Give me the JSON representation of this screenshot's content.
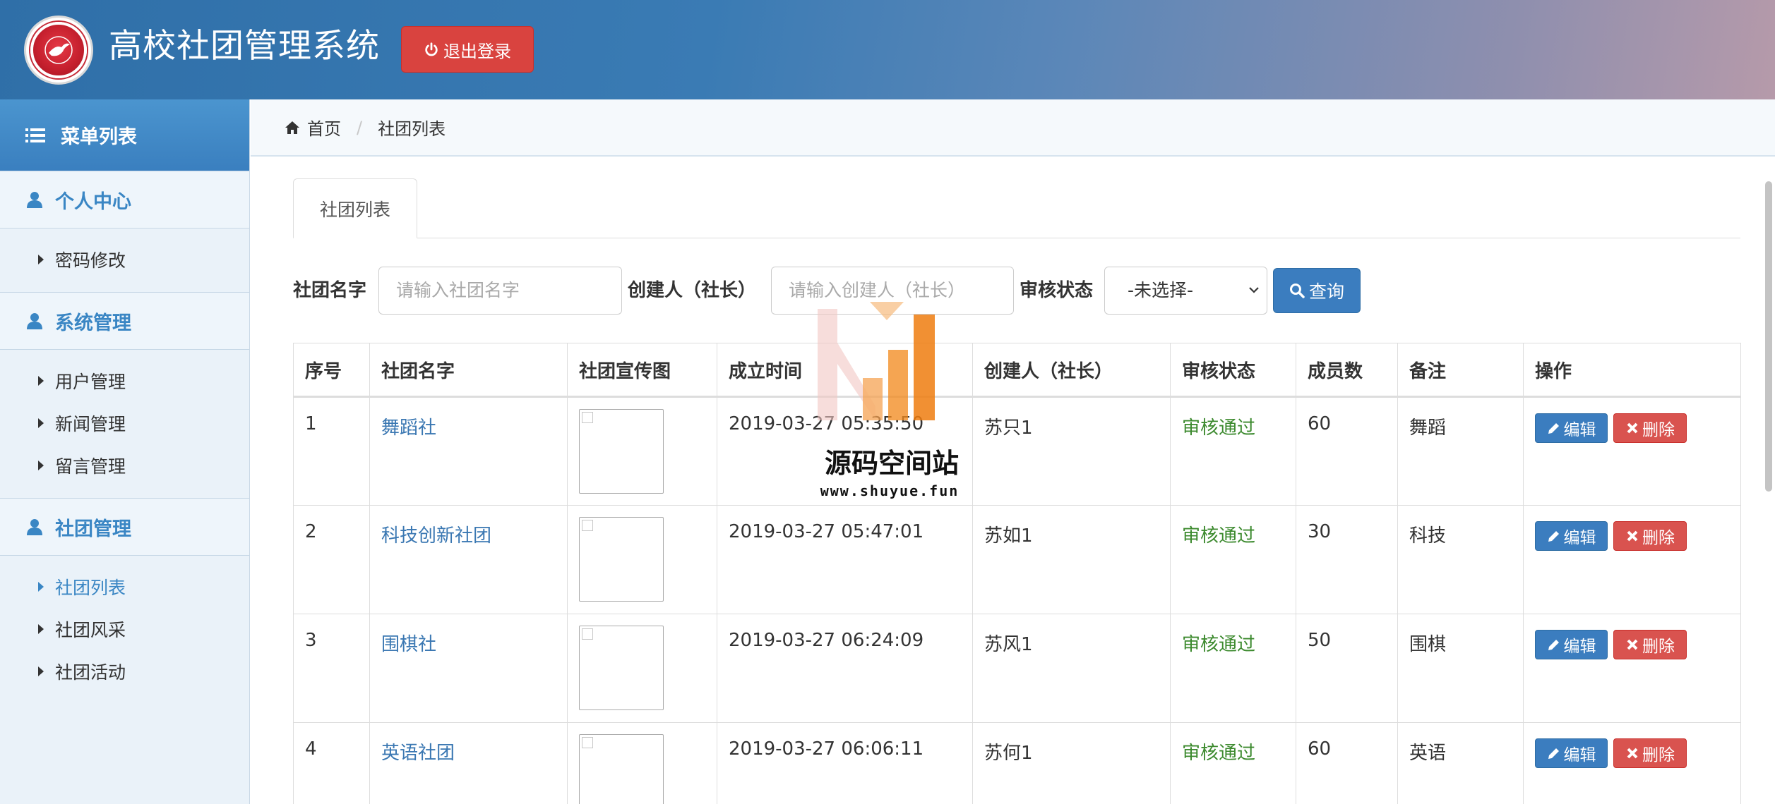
{
  "header": {
    "app_title": "高校社团管理系统",
    "logout_label": "退出登录",
    "colors": {
      "logout": "#d9433f",
      "header_start": "#2f6fa8",
      "header_end": "#b69aaa"
    }
  },
  "sidebar": {
    "menu_title": "菜单列表",
    "groups": [
      {
        "title": "个人中心",
        "items": [
          {
            "label": "密码修改"
          }
        ]
      },
      {
        "title": "系统管理",
        "items": [
          {
            "label": "用户管理"
          },
          {
            "label": "新闻管理"
          },
          {
            "label": "留言管理"
          }
        ]
      },
      {
        "title": "社团管理",
        "items": [
          {
            "label": "社团列表",
            "active": true
          },
          {
            "label": "社团风采"
          },
          {
            "label": "社团活动"
          }
        ]
      }
    ]
  },
  "breadcrumb": {
    "home": "首页",
    "current": "社团列表"
  },
  "tab": {
    "label": "社团列表"
  },
  "search": {
    "name_label": "社团名字",
    "name_placeholder": "请输入社团名字",
    "creator_label": "创建人（社长）",
    "creator_placeholder": "请输入创建人（社长）",
    "status_label": "审核状态",
    "status_selected": "-未选择-",
    "query_label": "查询"
  },
  "table": {
    "headers": [
      "序号",
      "社团名字",
      "社团宣传图",
      "成立时间",
      "创建人（社长）",
      "审核状态",
      "成员数",
      "备注",
      "操作"
    ],
    "edit_label": "编辑",
    "delete_label": "删除",
    "rows": [
      {
        "no": "1",
        "name": "舞蹈社",
        "time": "2019-03-27 05:35:50",
        "creator": "苏只1",
        "status": "审核通过",
        "members": "60",
        "note": "舞蹈"
      },
      {
        "no": "2",
        "name": "科技创新社团",
        "time": "2019-03-27 05:47:01",
        "creator": "苏如1",
        "status": "审核通过",
        "members": "30",
        "note": "科技"
      },
      {
        "no": "3",
        "name": "围棋社",
        "time": "2019-03-27 06:24:09",
        "creator": "苏风1",
        "status": "审核通过",
        "members": "50",
        "note": "围棋"
      },
      {
        "no": "4",
        "name": "英语社团",
        "time": "2019-03-27 06:06:11",
        "creator": "苏何1",
        "status": "审核通过",
        "members": "60",
        "note": "英语"
      }
    ]
  },
  "watermark": {
    "title": "源码空间站",
    "url": "www.shuyue.fun"
  }
}
